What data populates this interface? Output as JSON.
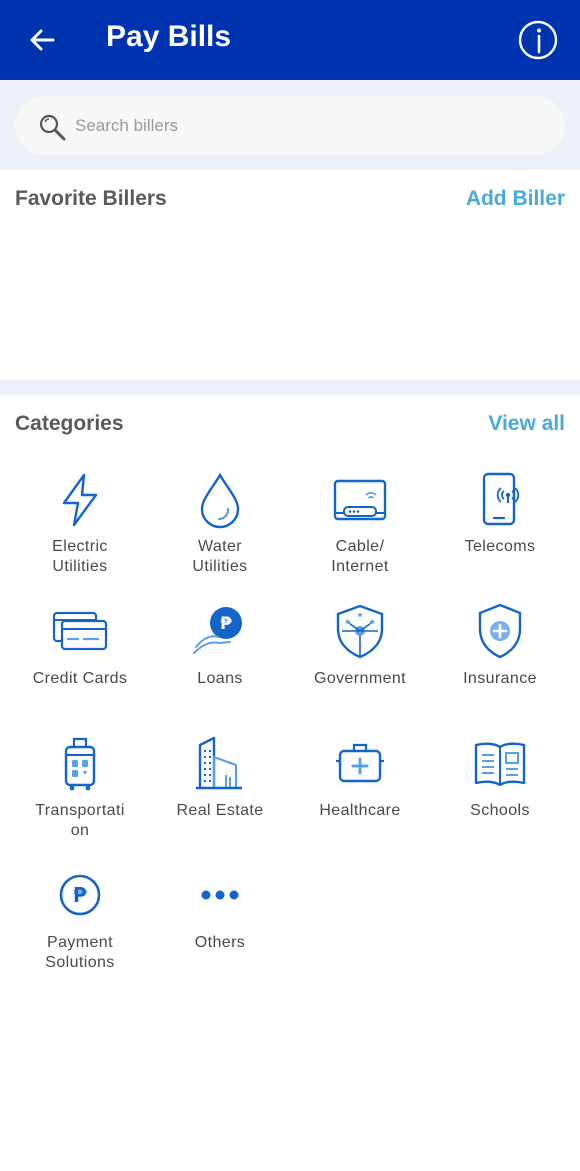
{
  "header": {
    "title": "Pay Bills",
    "back_icon": "arrow-left-icon",
    "info_icon": "info-icon",
    "background": "#0033b0"
  },
  "search": {
    "placeholder": "Search billers",
    "value": "",
    "icon": "search-icon"
  },
  "favorites": {
    "title": "Favorite Billers",
    "action": "Add Biller"
  },
  "categories": {
    "title": "Categories",
    "action": "View all",
    "items": [
      {
        "label": "Electric\nUtilities",
        "icon": "lightning-icon"
      },
      {
        "label": "Water\nUtilities",
        "icon": "water-drop-icon"
      },
      {
        "label": "Cable/\nInternet",
        "icon": "router-icon"
      },
      {
        "label": "Telecoms",
        "icon": "mobile-phone-icon"
      },
      {
        "label": "Credit Cards",
        "icon": "credit-card-icon"
      },
      {
        "label": "Loans",
        "icon": "loan-icon"
      },
      {
        "label": "Government",
        "icon": "government-shield-icon"
      },
      {
        "label": "Insurance",
        "icon": "insurance-shield-icon"
      },
      {
        "label": "Transportati\non",
        "icon": "luggage-icon"
      },
      {
        "label": "Real Estate",
        "icon": "building-icon"
      },
      {
        "label": "Healthcare",
        "icon": "medical-kit-icon"
      },
      {
        "label": "Schools",
        "icon": "book-icon"
      },
      {
        "label": "Payment\nSolutions",
        "icon": "peso-coin-icon"
      },
      {
        "label": "Others",
        "icon": "more-dots-icon"
      }
    ]
  },
  "colors": {
    "primary": "#0033b0",
    "icon": "#1565c8",
    "accent_link": "#4aaad6",
    "band": "#ecf1fa"
  }
}
